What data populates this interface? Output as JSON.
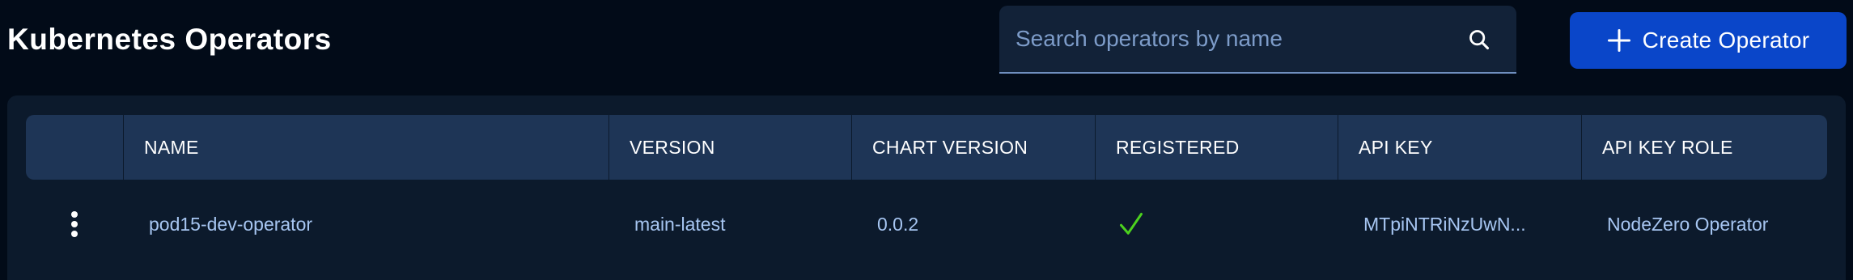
{
  "header": {
    "title": "Kubernetes Operators",
    "search_placeholder": "Search operators by name",
    "search_value": "",
    "create_button_label": "Create Operator"
  },
  "table": {
    "columns": [
      "",
      "NAME",
      "VERSION",
      "CHART VERSION",
      "REGISTERED",
      "API KEY",
      "API KEY ROLE"
    ],
    "rows": [
      {
        "name": "pod15-dev-operator",
        "version": "main-latest",
        "chart_version": "0.0.2",
        "registered": true,
        "api_key": "MTpiNTRiNzUwN...",
        "api_key_role": "NodeZero Operator"
      }
    ]
  },
  "colors": {
    "background": "#020b18",
    "accent": "#0a46c9",
    "header_row": "#1e3556",
    "link_text": "#a7c6f2",
    "check": "#4cd21e"
  },
  "icons": [
    "search-icon",
    "plus-icon",
    "kebab-menu-icon",
    "check-icon"
  ]
}
